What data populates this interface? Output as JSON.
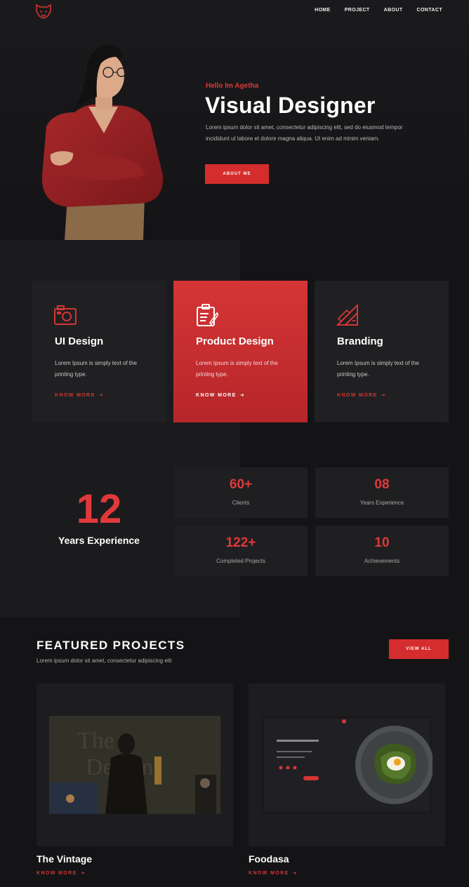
{
  "nav": {
    "items": [
      "HOME",
      "PROJECT",
      "ABOUT",
      "CONTACT"
    ]
  },
  "hero": {
    "hello": "Hello Im Agetha",
    "title": "Visual Designer",
    "text": "Lorem ipsum dolor sit amet, consectetur adipiscing elit, sed do eiusmod tempor incididunt ut labore et dolore magna aliqua. Ut enim ad minim veniam.",
    "button": "ABOUT ME"
  },
  "services": [
    {
      "title": "UI Design",
      "text": "Lorem Ipsum is simply text of the printing type.",
      "link": "KNOW MORE",
      "icon": "camera-icon"
    },
    {
      "title": "Product Design",
      "text": "Lorem Ipsum is simply text of the printing type.",
      "link": "KNOW MORE",
      "icon": "clipboard-icon"
    },
    {
      "title": "Branding",
      "text": "Lorem Ipsum is simply text of the printing type.",
      "link": "KNOW MORE",
      "icon": "ruler-pencil-icon"
    }
  ],
  "experience": {
    "number": "12",
    "label": "Years Experience"
  },
  "stats": [
    {
      "value": "60+",
      "label": "Clients"
    },
    {
      "value": "08",
      "label": "Years Experience"
    },
    {
      "value": "122+",
      "label": "Completed Projects"
    },
    {
      "value": "10",
      "label": "Achievements"
    }
  ],
  "featured": {
    "title": "FEATURED PROJECTS",
    "subtitle": "Lorem ipsum dolor sit amet, consectetur adipiscing elit",
    "button": "VIEW ALL",
    "projects": [
      {
        "name": "The Vintage",
        "link": "KNOW MORE"
      },
      {
        "name": "Foodasa",
        "link": "KNOW MORE"
      }
    ]
  },
  "colors": {
    "accent": "#d53535",
    "background": "#141416",
    "card": "#202022"
  }
}
